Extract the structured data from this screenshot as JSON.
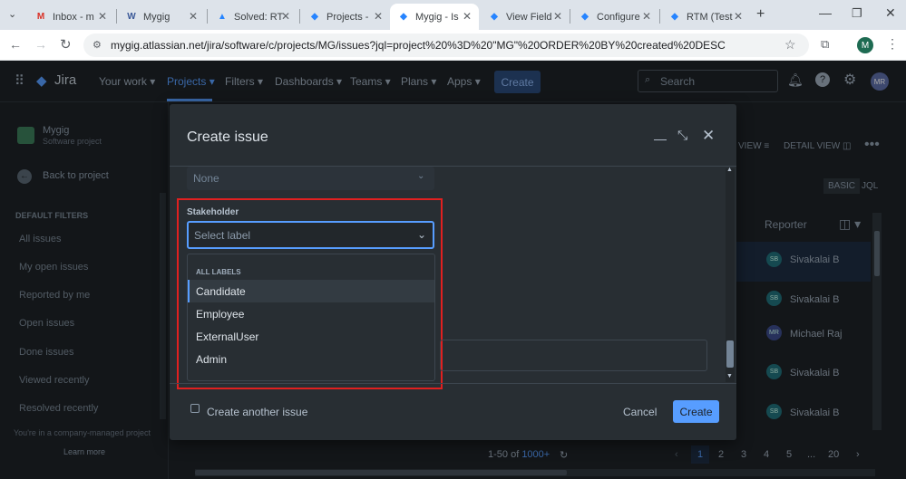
{
  "browser": {
    "tabs": [
      {
        "label": "Inbox - m",
        "icon": "gmail-icon"
      },
      {
        "label": "Mygig",
        "icon": "w-icon"
      },
      {
        "label": "Solved: RT",
        "icon": "atlassian-icon"
      },
      {
        "label": "Projects - ",
        "icon": "jira-icon"
      },
      {
        "label": "Mygig - Is",
        "icon": "jira-icon"
      },
      {
        "label": "View Field",
        "icon": "jira-icon"
      },
      {
        "label": "Configure",
        "icon": "jira-icon"
      },
      {
        "label": "RTM (Test",
        "icon": "jira-icon"
      }
    ],
    "url": "mygig.atlassian.net/jira/software/c/projects/MG/issues?jql=project%20%3D%20\"MG\"%20ORDER%20BY%20created%20DESC",
    "profile_initial": "M"
  },
  "jira_nav": {
    "logo": "Jira",
    "items": [
      "Your work",
      "Projects",
      "Filters",
      "Dashboards",
      "Teams",
      "Plans",
      "Apps"
    ],
    "create_label": "Create",
    "search_placeholder": "Search",
    "avatar": "MR"
  },
  "sidebar": {
    "project_name": "Mygig",
    "project_type": "Software project",
    "back_label": "Back to project",
    "section_title": "DEFAULT FILTERS",
    "filters": [
      "All issues",
      "My open issues",
      "Reported by me",
      "Open issues",
      "Done issues",
      "Viewed recently",
      "Resolved recently"
    ],
    "footer_text": "You're in a company-managed project",
    "learn_more": "Learn more"
  },
  "background": {
    "view_label": "VIEW",
    "detail_view_label": "DETAIL VIEW",
    "basic_label": "BASIC",
    "jql_label": "JQL",
    "reporter_header": "Reporter",
    "reporters": [
      {
        "initials": "SB",
        "name": "Sivakalai B"
      },
      {
        "initials": "SB",
        "name": "Sivakalai B"
      },
      {
        "initials": "MR",
        "name": "Michael Raj"
      },
      {
        "initials": "SB",
        "name": "Sivakalai B"
      },
      {
        "initials": "SB",
        "name": "Sivakalai B"
      }
    ],
    "pagination_range": "1-50 of",
    "pagination_total": "1000+",
    "pages": [
      "1",
      "2",
      "3",
      "4",
      "5",
      "...",
      "20"
    ]
  },
  "modal": {
    "title": "Create issue",
    "prev_field_value": "None",
    "stakeholder_label": "Stakeholder",
    "select_placeholder": "Select label",
    "menu_group": "ALL LABELS",
    "options": [
      "Candidate",
      "Employee",
      "ExternalUser",
      "Admin"
    ],
    "create_another_label": "Create another issue",
    "cancel_label": "Cancel",
    "create_label": "Create"
  }
}
